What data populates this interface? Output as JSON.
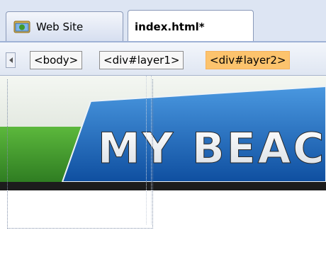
{
  "tabs": [
    {
      "label": "Web Site",
      "icon": "website-icon",
      "active": false
    },
    {
      "label": "index.html*",
      "active": true
    }
  ],
  "tag_selector": {
    "items": [
      "<body>",
      "<div#layer1>",
      "<div#layer2>"
    ],
    "selected": "<div#layer2>",
    "highlight_color": "#fcc36d"
  },
  "banner": {
    "text": "MY BEAC",
    "colors": {
      "green": "#3f9a2c",
      "blue": "#1f73c7",
      "dark_band": "#1c1c1c"
    }
  }
}
